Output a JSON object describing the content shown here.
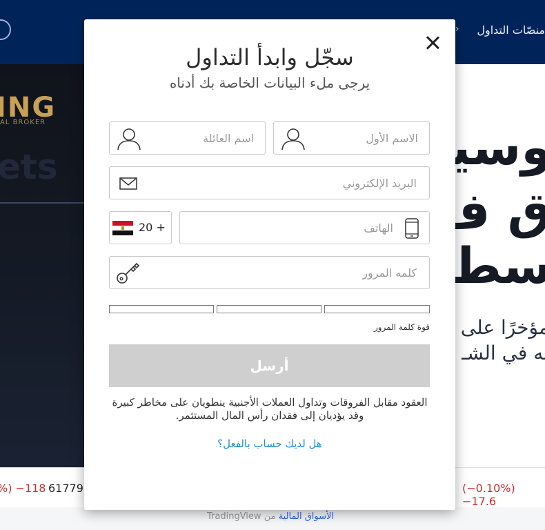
{
  "background": {
    "header": {
      "nav_label": "منصّات التداول",
      "nav_chevron": "›"
    },
    "hero": {
      "brand_partial": "ING",
      "brand_sub_partial": "AL BROKER",
      "tagline_partial": "ets",
      "right_big_1": "وسيـ",
      "right_big_2": "ق ف",
      "right_big_3": "سطـ",
      "right_lead_1": "مؤخرًا على جـ",
      "right_lead_2": "به في الشـ"
    },
    "ticker": {
      "left_change": "%) −118",
      "left_value": "61779",
      "right_change": "(−0.10%) −17.6"
    },
    "footer": {
      "link": "الأسواق المالية",
      "from": "من",
      "provider": "TradingView"
    }
  },
  "modal": {
    "title": "سجّل وابدأ التداول",
    "subtitle": "يرجى ملء البيانات الخاصة بك أدناه",
    "close_icon": "close-icon",
    "fields": {
      "first_name_placeholder": "الاسم الأول",
      "last_name_placeholder": "اسم العائلة",
      "email_placeholder": "البريد الإلكتروني",
      "phone_placeholder": "الهاتف",
      "password_placeholder": "كلمه المرور",
      "country_code": "20 +",
      "country_flag": "egypt-flag-icon"
    },
    "strength_label": "قوة كلمة المرور",
    "submit_label": "أرسل",
    "disclaimer": "العقود مقابل الفروقات وتداول العملات الأجنبية ينطويان على مخاطر كبيرة وقد يؤديان إلى فقدان رأس المال المستثمر.",
    "login_link": "هل لديك حساب بالفعل؟",
    "colors": {
      "submit_disabled": "#cfcfcf",
      "link": "#1a8fd6",
      "header_bg": "#00245a"
    }
  }
}
